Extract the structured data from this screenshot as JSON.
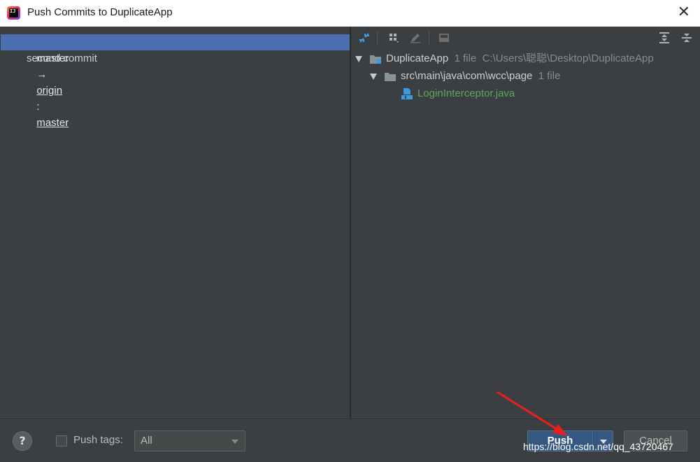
{
  "window": {
    "title": "Push Commits to DuplicateApp",
    "app_icon_text": "IJ",
    "close_symbol": "✕"
  },
  "left": {
    "branch": {
      "local": "master",
      "arrow": "→",
      "remote": "origin",
      "sep": ":",
      "remote_branch": "master"
    },
    "commits": [
      {
        "message": "second commit"
      }
    ]
  },
  "toolbar": {
    "icons": [
      "collapse-arrows-icon",
      "group-by-icon",
      "edit-icon",
      "diff-icon",
      "expand-all-icon",
      "collapse-all-icon"
    ]
  },
  "tree": {
    "root": {
      "name": "DuplicateApp",
      "count": "1 file",
      "path": "C:\\Users\\聪聪\\Desktop\\DuplicateApp"
    },
    "folder": {
      "name": "src\\main\\java\\com\\wcc\\page",
      "count": "1 file"
    },
    "file": {
      "name": "LoginInterceptor.java"
    }
  },
  "bottom": {
    "help_label": "?",
    "push_tags_label": "Push tags:",
    "push_tags_checked": false,
    "tags_select_value": "All",
    "push_label": "Push",
    "cancel_label": "Cancel"
  },
  "watermark": "https://blog.csdn.net/qq_43720467",
  "colors": {
    "selection": "#4b6eaf",
    "java_file": "#62a35d",
    "primary_button": "#365880",
    "annotation_arrow": "#e8211b"
  }
}
